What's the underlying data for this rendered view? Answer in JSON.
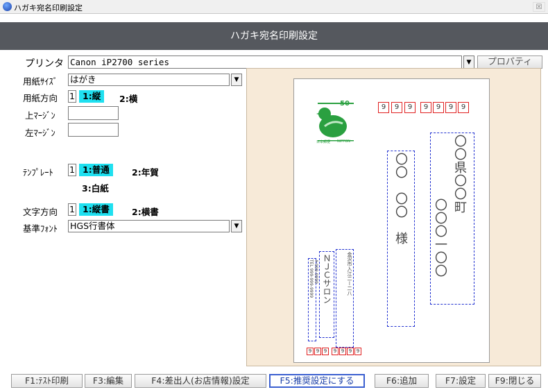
{
  "window": {
    "title": "ハガキ宛名印刷設定",
    "close": "☒"
  },
  "header": {
    "title": "ハガキ宛名印刷設定"
  },
  "form": {
    "printer_label": "プリンタ",
    "printer_value": "Canon iP2700 series",
    "property_button": "プロパティ",
    "paper_size_label": "用紙ｻｲｽﾞ",
    "paper_size_value": "はがき",
    "orientation_label": "用紙方向",
    "orientation_value": "1",
    "orientation_opt1": "1:縦",
    "orientation_opt2": "2:横",
    "top_margin_label": "上ﾏｰｼﾞﾝ",
    "top_margin_value": "",
    "left_margin_label": "左ﾏｰｼﾞﾝ",
    "left_margin_value": "",
    "template_label": "ﾃﾝﾌﾟﾚｰﾄ",
    "template_value": "1",
    "template_opt1": "1:普通",
    "template_opt2": "2:年賀",
    "template_opt3": "3:白紙",
    "text_dir_label": "文字方向",
    "text_dir_value": "1",
    "text_dir_opt1": "1:縦書",
    "text_dir_opt2": "2:横書",
    "font_label": "基準ﾌｫﾝﾄ",
    "font_value": "HGS行書体"
  },
  "preview": {
    "stamp_value": "50",
    "stamp_caption1": "日本郵便",
    "stamp_caption2": "NIPPON",
    "postal_digits": [
      "9",
      "9",
      "9",
      "9",
      "9",
      "9",
      "9"
    ],
    "address1": "〇〇県〇〇町",
    "address2": "〇〇〇一〇〇",
    "name": "〇〇　〇〇　様",
    "sender_postal": "〒999-9999",
    "sender_address": "TEL 999-999-9999",
    "sender_addr_long": "金沢市入江二ー二八",
    "sender_name": "ＮＪＣサロン",
    "sender_digits": [
      "9",
      "9",
      "9",
      "9",
      "9",
      "9",
      "9"
    ]
  },
  "function_keys": [
    {
      "key": "f1",
      "label": "F1:ﾃｽﾄ印刷"
    },
    {
      "key": "f3",
      "label": "F3:編集"
    },
    {
      "key": "f4",
      "label": "F4:差出人(お店情報)設定"
    },
    {
      "key": "f5",
      "label": "F5:推奨設定にする"
    },
    {
      "key": "f6",
      "label": "F6:追加"
    },
    {
      "key": "f7",
      "label": "F7:設定"
    },
    {
      "key": "f9",
      "label": "F9:閉じる"
    }
  ],
  "colors": {
    "header": "#55585e",
    "accent_cyan": "#1fe0f0",
    "preview_bg": "#f7ead8",
    "stamp_green": "#2aa040"
  },
  "icons": {
    "app": "app-icon",
    "dropdown": "dropdown-arrow-icon",
    "stamp": "mandarin-duck-stamp-icon"
  }
}
